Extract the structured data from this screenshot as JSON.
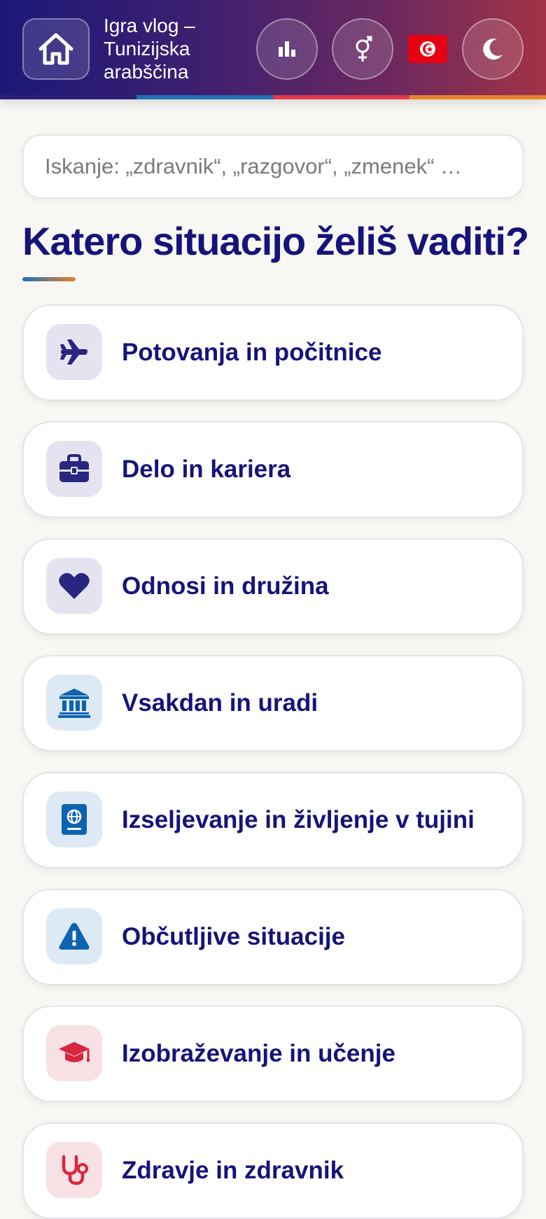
{
  "header": {
    "title": "Igra vlog – Tunizijska arabščina",
    "stripe_colors": [
      "#2a1f78",
      "#1f6fb8",
      "#e23a4a",
      "#e8842c"
    ],
    "buttons": [
      {
        "name": "home",
        "icon": "home-icon"
      },
      {
        "name": "stats",
        "icon": "bar-chart-icon"
      },
      {
        "name": "gender",
        "icon": "gender-icon"
      },
      {
        "name": "language-flag",
        "icon": "tunisia-flag-icon"
      },
      {
        "name": "theme",
        "icon": "moon-icon"
      }
    ]
  },
  "search": {
    "placeholder": "Iskanje: „zdravnik“, „razgovor“, „zmenek“ …"
  },
  "main": {
    "heading": "Katero situacijo želiš vaditi?",
    "categories": [
      {
        "label": "Potovanja in počitnice",
        "icon": "airplane-icon",
        "icon_color": "#2a2580",
        "icon_bg": "#e4e3ef"
      },
      {
        "label": "Delo in kariera",
        "icon": "briefcase-icon",
        "icon_color": "#2a2580",
        "icon_bg": "#e4e3ef"
      },
      {
        "label": "Odnosi in družina",
        "icon": "heart-icon",
        "icon_color": "#2a2580",
        "icon_bg": "#e4e3ef"
      },
      {
        "label": "Vsakdan in uradi",
        "icon": "bank-icon",
        "icon_color": "#0d63b0",
        "icon_bg": "#dde9f5"
      },
      {
        "label": "Izseljevanje in življenje v tujini",
        "icon": "passport-icon",
        "icon_color": "#0d63b0",
        "icon_bg": "#dde9f5"
      },
      {
        "label": "Občutljive situacije",
        "icon": "warning-icon",
        "icon_color": "#0d63b0",
        "icon_bg": "#dde9f5"
      },
      {
        "label": "Izobraževanje in učenje",
        "icon": "graduation-cap-icon",
        "icon_color": "#d7263d",
        "icon_bg": "#f8e1e4"
      },
      {
        "label": "Zdravje in zdravnik",
        "icon": "stethoscope-icon",
        "icon_color": "#d7263d",
        "icon_bg": "#f8e1e4"
      }
    ]
  }
}
